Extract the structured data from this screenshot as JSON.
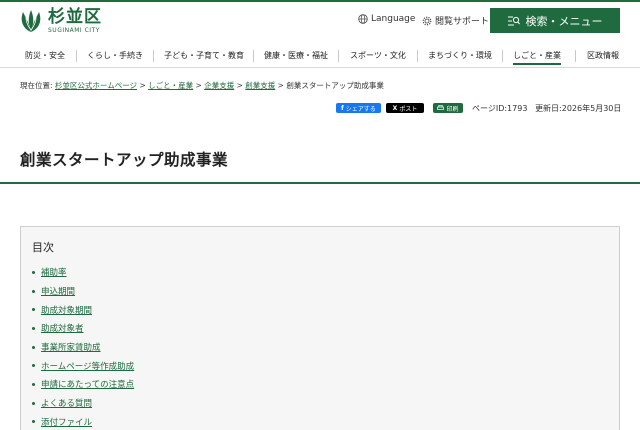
{
  "header": {
    "logo_jp": "杉並区",
    "logo_en": "SUGINAMI CITY",
    "language_label": "Language",
    "reading_support_label": "閲覧サポート",
    "search_menu_label": "検索・メニュー"
  },
  "nav": {
    "items": [
      {
        "label": "防災・安全"
      },
      {
        "label": "くらし・手続き"
      },
      {
        "label": "子ども・子育て・教育"
      },
      {
        "label": "健康・医療・福祉"
      },
      {
        "label": "スポーツ・文化"
      },
      {
        "label": "まちづくり・環境"
      },
      {
        "label": "しごと・産業",
        "active": true
      },
      {
        "label": "区政情報"
      }
    ]
  },
  "breadcrumb": {
    "prefix": "現在位置:",
    "links": [
      "杉並区公式ホームページ",
      "しごと・産業",
      "企業支援",
      "創業支援"
    ],
    "separator": ">",
    "current": "創業スタートアップ助成事業"
  },
  "share": {
    "facebook_label": "シェアする",
    "x_label": "ポスト",
    "print_label": "印刷"
  },
  "meta": {
    "page_id": "ページID:1793",
    "updated": "更新日:2026年5月30日"
  },
  "page_title": "創業スタートアップ助成事業",
  "toc": {
    "heading": "目次",
    "items": [
      "補助率",
      "申込期間",
      "助成対象期間",
      "助成対象者",
      "事業所家賃助成",
      "ホームページ等作成助成",
      "申請にあたっての注意点",
      "よくある質問",
      "添付ファイル"
    ]
  },
  "colors": {
    "brand_green": "#1f6a3e",
    "facebook_blue": "#1877f2",
    "x_black": "#000000"
  }
}
